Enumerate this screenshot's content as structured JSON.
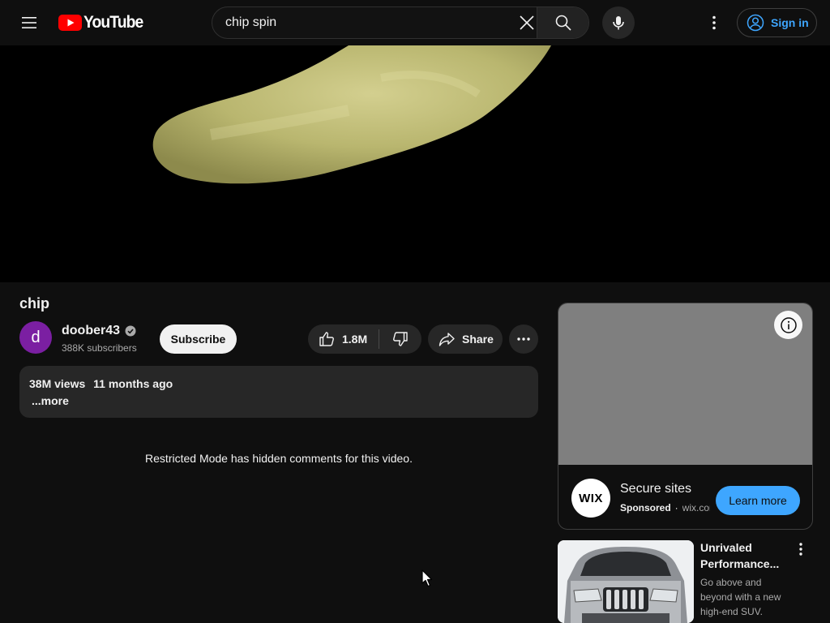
{
  "header": {
    "logo_text": "YouTube",
    "search_value": "chip spin",
    "sign_in_label": "Sign in"
  },
  "video": {
    "title": "chip",
    "channel_name": "doober43",
    "avatar_letter": "d",
    "subscribers": "388K subscribers",
    "subscribe_label": "Subscribe",
    "likes": "1.8M",
    "share_label": "Share",
    "views": "38M views",
    "age": "11 months ago",
    "more_label": "...more",
    "restricted_notice": "Restricted Mode has hidden comments for this video."
  },
  "ad": {
    "logo_text": "WIX",
    "title": "Secure sites",
    "sponsored": "Sponsored",
    "separator": "·",
    "domain": "wix.com",
    "cta": "Learn more"
  },
  "ad2": {
    "title_line1": "Unrivaled",
    "title_line2": "Performance...",
    "description": "Go above and beyond with a new high-end SUV."
  },
  "colors": {
    "background": "#0f0f0f",
    "accent_blue": "#3ea6ff",
    "button_bg": "#272727",
    "brand_red": "#ff0000",
    "avatar_purple": "#7b1fa2"
  },
  "icons": [
    "menu-icon",
    "youtube-logo-icon",
    "clear-icon",
    "search-icon",
    "mic-icon",
    "more-vert-icon",
    "account-icon",
    "verified-icon",
    "thumb-up-icon",
    "thumb-down-icon",
    "share-icon",
    "more-horiz-icon",
    "info-icon"
  ]
}
